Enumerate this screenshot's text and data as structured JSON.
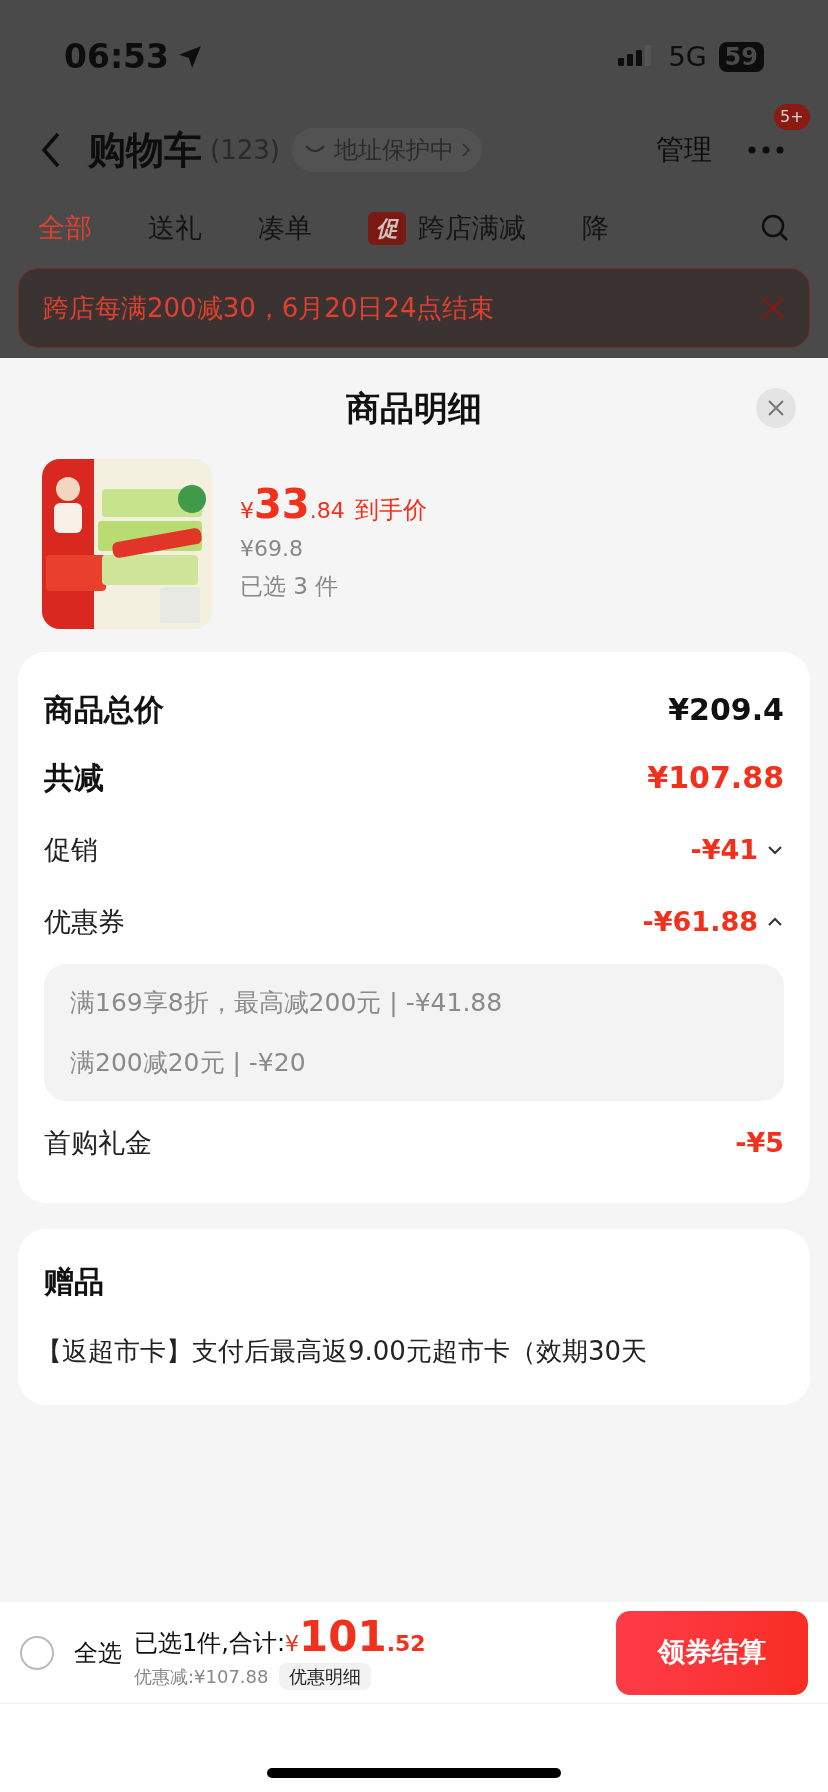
{
  "status_bar": {
    "time": "06:53",
    "network": "5G",
    "battery": "59"
  },
  "header": {
    "title": "购物车",
    "count": "(123)",
    "address_badge": "地址保护中",
    "manage": "管理",
    "badge": "5+"
  },
  "tabs": [
    {
      "label": "全部",
      "selected": true
    },
    {
      "label": "送礼",
      "selected": false
    },
    {
      "label": "凑单",
      "selected": false
    },
    {
      "label": "跨店满减",
      "selected": false,
      "tag": "促"
    },
    {
      "label": "降",
      "selected": false
    }
  ],
  "banner": {
    "text": "跨店每满200减30，6月20日24点结束"
  },
  "sheet": {
    "title": "商品明细",
    "product": {
      "currency": "¥",
      "price_int": "33",
      "price_dec": ".84",
      "price_label": "到手价",
      "original_price": "¥69.8",
      "selected_count": "已选 3 件"
    },
    "summary": {
      "total": {
        "label": "商品总价",
        "value": "¥209.4"
      },
      "discount": {
        "label": "共减",
        "value": "¥107.88"
      },
      "lines": [
        {
          "kind": "toggle",
          "label": "促销",
          "value": "-¥41",
          "expanded": false
        },
        {
          "kind": "toggle",
          "label": "优惠券",
          "value": "-¥61.88",
          "expanded": true,
          "details": [
            "满169享8折，最高减200元 | -¥41.88",
            "满200减20元 | -¥20"
          ]
        },
        {
          "kind": "plain",
          "label": "首购礼金",
          "value": "-¥5"
        }
      ]
    },
    "gifts": {
      "title": "赠品",
      "text": "【返超市卡】支付后最高返9.00元超市卡（效期30天"
    }
  },
  "bottom_bar": {
    "select_all": {
      "label": "全选",
      "checked": false
    },
    "summary": "已选1件,合计:",
    "currency": "¥",
    "total_int": "101",
    "total_dec": ".52",
    "saved": "优惠减:¥107.88",
    "detail_button": "优惠明细",
    "checkout": "领券结算"
  }
}
